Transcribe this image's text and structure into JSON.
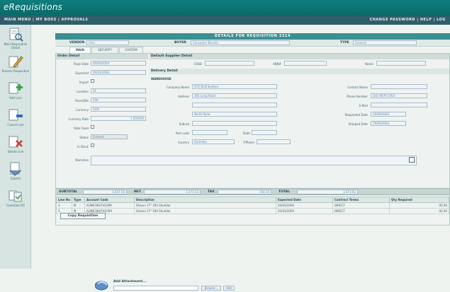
{
  "app": {
    "brand": "eRequisitions"
  },
  "nav": {
    "left": "MAIN MENU  |  MY BOXS  |  APPROVALS",
    "right": "CHANGE PASSWORD  |  HELP  |  LOG"
  },
  "sidebar": {
    "items": [
      {
        "label": "Main Requisition Detail",
        "icon": "document-magnifier-icon"
      },
      {
        "label": "Process Requisition",
        "icon": "pencil-edit-icon"
      },
      {
        "label": "Add Line",
        "icon": "add-line-icon"
      },
      {
        "label": "Cancel Line",
        "icon": "cancel-line-icon"
      },
      {
        "label": "Delete Line",
        "icon": "delete-line-icon"
      },
      {
        "label": "Submit",
        "icon": "submit-icon"
      },
      {
        "label": "Generate PO",
        "icon": "generate-po-icon"
      }
    ]
  },
  "title": "DETAILS FOR REQUISITION 3314",
  "header": {
    "vendor_label": "VENDOR",
    "vendor_value": "Vine",
    "buyer_label": "BUYER",
    "buyer_value": "Consumer Brands",
    "type_label": "TYPE",
    "type_value": "General"
  },
  "tabs": [
    "MAIN",
    "SECURITY",
    "CUSTOM"
  ],
  "order_detail": {
    "section": "Order Detail",
    "fields": [
      {
        "label": "Reqn Date",
        "value": "09/03/2004"
      },
      {
        "label": "Expected",
        "value": "09/03/2004"
      },
      {
        "label": "Import"
      },
      {
        "label": "Location",
        "value": "01"
      },
      {
        "label": "Store/Dte",
        "value": "100"
      },
      {
        "label": "Currency",
        "value": "AUD"
      },
      {
        "label": "Currency Rate",
        "value": "1.000000"
      },
      {
        "label": "Rate Fixed"
      },
      {
        "label": "Status",
        "value": "Entered"
      },
      {
        "label": "In Stock"
      }
    ]
  },
  "supplier": {
    "section": "Default Supplier Detail",
    "code_label": "CODE",
    "abn_label": "ABN#",
    "name_label": "Name"
  },
  "delivery": {
    "section": "Delivery Detail",
    "warehouse": "WAREHOUSE",
    "company_label": "Company Name",
    "company_value": "XYZ Distributions",
    "address_label": "Address",
    "address_value": "364 Long Road",
    "city_value": "North Ryde",
    "suburb_label": "Suburb",
    "postcode_label": "Post code",
    "state_label": "State",
    "country_label": "Country",
    "country_value": "Australia",
    "tphone_label": "T/Phone",
    "contact_label": "Contact Name",
    "phone_label": "Phone Number",
    "phone_value": "(02) 9876 5454",
    "email_label": "E-Mail",
    "requested_label": "Requested Date",
    "requested_value": "19/09/2004",
    "shipped_label": "Shipped Date",
    "shipped_value": "19/09/2004"
  },
  "narrative_label": "Narrative",
  "totals": {
    "subtotal_label": "SUBTOTAL",
    "subtotal": "1,657.50",
    "net_label": "NET",
    "net": "1,571.53",
    "tax_label": "TAX",
    "tax": "154.15",
    "total_label": "TOTAL",
    "total": "1,673.62"
  },
  "grid": {
    "columns": [
      "Line No",
      "Type",
      "Account Code",
      "Description",
      "Expected Date",
      "Contract Terms",
      "Qty Required"
    ],
    "rows": [
      {
        "line": "1",
        "type": "M",
        "acct": "AUN6789/TH1009",
        "desc": "Shears 17\" 100 Shudder",
        "exp": "20/03/2004",
        "terms": "DIRECT",
        "qty": "00.00"
      },
      {
        "line": "2",
        "type": "M",
        "acct": "AUN6789/TH1009",
        "desc": "Shears 17\" 100 Shudder",
        "exp": "20/03/2004",
        "terms": "DIRECT",
        "qty": "00.00"
      }
    ]
  },
  "copy_button": "Copy Requisition",
  "attachments": {
    "label": "Add Attachment...",
    "browse": "Browse...",
    "add": "Add"
  },
  "colors": {
    "topbar": "#0a6a68",
    "navbar": "#2f5e6b",
    "title": "#3a8f93",
    "accent_text": "#5d86b4"
  }
}
